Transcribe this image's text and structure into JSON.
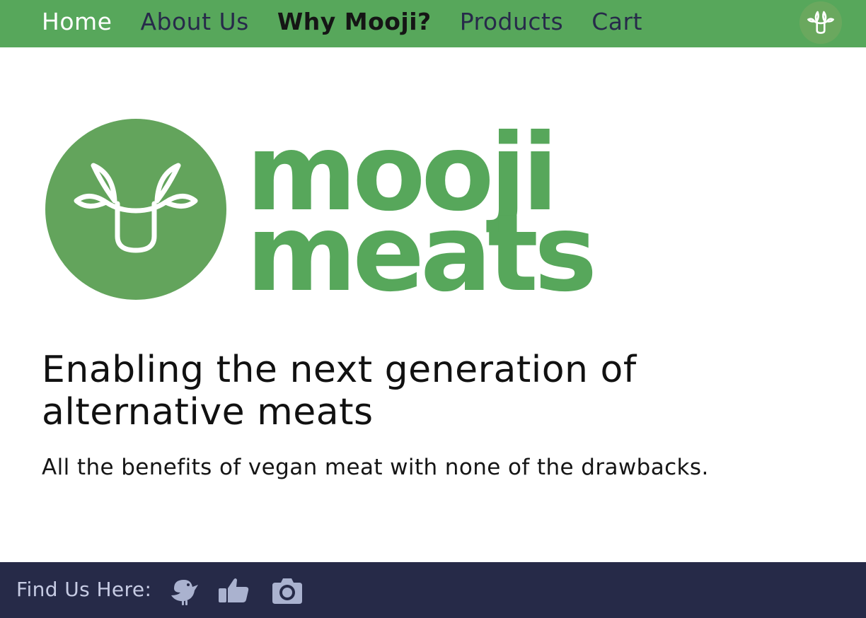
{
  "nav": {
    "items": [
      {
        "label": "Home",
        "state": "home"
      },
      {
        "label": "About Us",
        "state": ""
      },
      {
        "label": "Why Mooji?",
        "state": "active"
      },
      {
        "label": "Products",
        "state": ""
      },
      {
        "label": "Cart",
        "state": ""
      }
    ],
    "logo_icon": "cow-leaf-icon"
  },
  "brand": {
    "wordmark_line1": "mooji",
    "wordmark_line2": "meats",
    "logo_icon": "cow-leaf-icon",
    "color": "#57a75b"
  },
  "hero": {
    "headline": "Enabling the next generation of alternative meats",
    "subline": "All the benefits of vegan meat with none of the drawbacks."
  },
  "footer": {
    "label": "Find Us Here:",
    "social": [
      {
        "icon": "bird-icon",
        "name": "twitter"
      },
      {
        "icon": "thumbs-up-icon",
        "name": "facebook"
      },
      {
        "icon": "camera-icon",
        "name": "instagram"
      }
    ],
    "background": "#262a48"
  },
  "colors": {
    "nav_bar": "#57a75b",
    "nav_text": "#272a4a",
    "nav_active_text": "#151515",
    "footer_text": "#c6cbe3"
  }
}
